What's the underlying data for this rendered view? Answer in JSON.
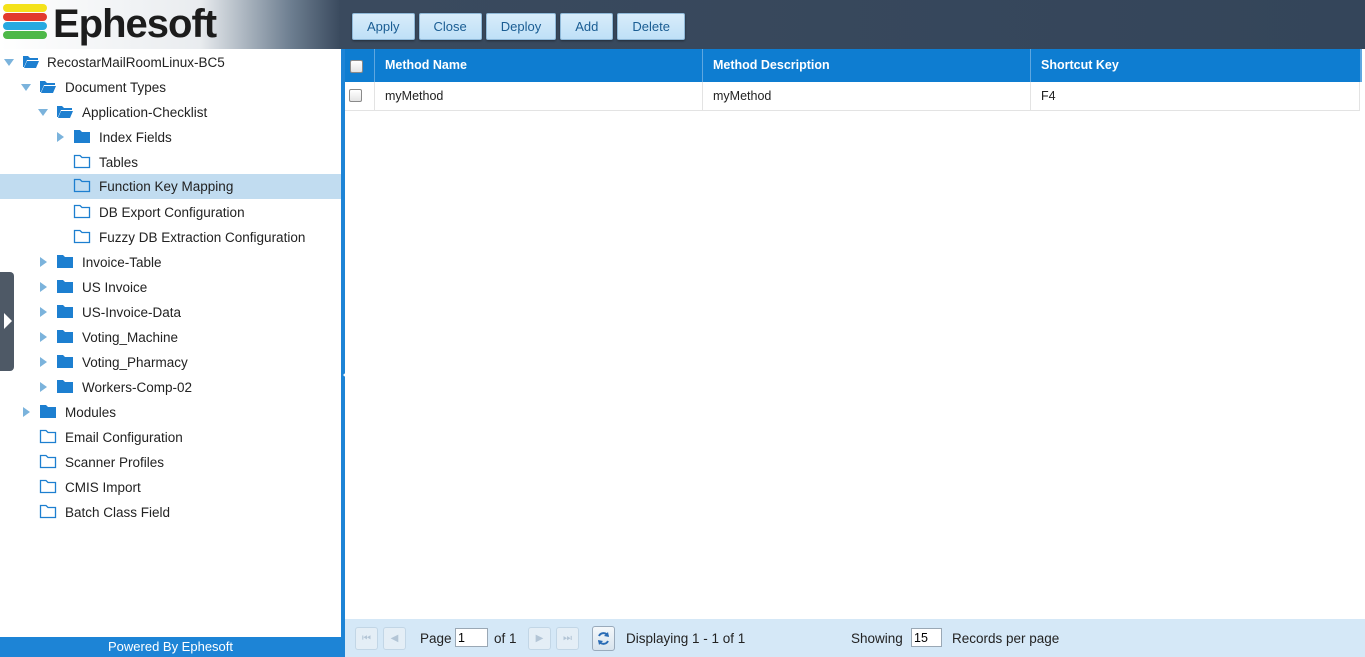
{
  "app": {
    "logo_text": "Ephesoft",
    "footer": "Powered By Ephesoft"
  },
  "toolbar": {
    "apply": "Apply",
    "close": "Close",
    "deploy": "Deploy",
    "add": "Add",
    "delete": "Delete"
  },
  "tree": {
    "root": "RecostarMailRoomLinux-BC5",
    "document_types": "Document Types",
    "application_checklist": "Application-Checklist",
    "index_fields": "Index Fields",
    "tables": "Tables",
    "function_key_mapping": "Function Key Mapping",
    "db_export": "DB Export Configuration",
    "fuzzy_db": "Fuzzy DB Extraction Configuration",
    "invoice_table": "Invoice-Table",
    "us_invoice": "US Invoice",
    "us_invoice_data": "US-Invoice-Data",
    "voting_machine": "Voting_Machine",
    "voting_pharmacy": "Voting_Pharmacy",
    "workers_comp": "Workers-Comp-02",
    "modules": "Modules",
    "email_config": "Email Configuration",
    "scanner_profiles": "Scanner Profiles",
    "cmis_import": "CMIS Import",
    "batch_class_field": "Batch Class Field",
    "selected": "Function Key Mapping"
  },
  "grid": {
    "columns": [
      "Method Name",
      "Method Description",
      "Shortcut Key"
    ],
    "rows": [
      [
        "myMethod",
        "myMethod",
        "F4"
      ]
    ]
  },
  "pager": {
    "page_label": "Page",
    "page_value": "1",
    "of_label": "of 1",
    "displaying": "Displaying 1 - 1 of 1",
    "showing_label": "Showing",
    "records_value": "15",
    "records_label": "Records per page"
  },
  "colors": {
    "accent": "#1d84d6",
    "header_bg": "#34455a",
    "selected_row": "#c1dcf0",
    "folder": "#1d7fd0"
  }
}
